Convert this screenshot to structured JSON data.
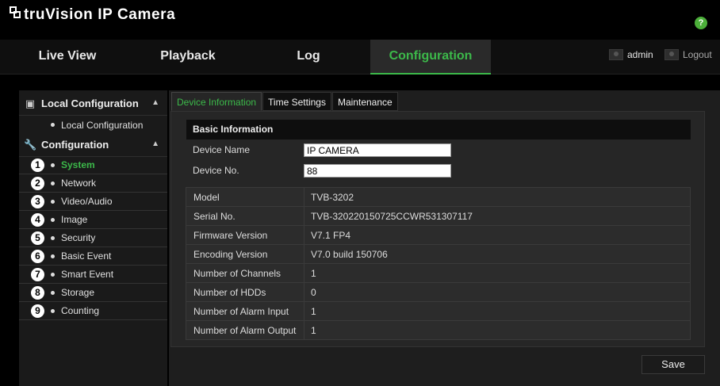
{
  "header": {
    "brand": "truVision  IP Camera",
    "help_glyph": "?"
  },
  "nav": {
    "tabs": [
      "Live View",
      "Playback",
      "Log",
      "Configuration"
    ],
    "active": "Configuration",
    "user_label": "admin",
    "logout_label": "Logout"
  },
  "sidebar": {
    "local": {
      "title": "Local Configuration",
      "items": [
        "Local Configuration"
      ]
    },
    "config": {
      "title": "Configuration",
      "items": [
        {
          "num": "1",
          "label": "System"
        },
        {
          "num": "2",
          "label": "Network"
        },
        {
          "num": "3",
          "label": "Video/Audio"
        },
        {
          "num": "4",
          "label": "Image"
        },
        {
          "num": "5",
          "label": "Security"
        },
        {
          "num": "6",
          "label": "Basic Event"
        },
        {
          "num": "7",
          "label": "Smart Event"
        },
        {
          "num": "8",
          "label": "Storage"
        },
        {
          "num": "9",
          "label": "Counting"
        }
      ]
    }
  },
  "tabs": [
    "Device Information",
    "Time Settings",
    "Maintenance"
  ],
  "basic": {
    "title": "Basic Information",
    "device_name_label": "Device Name",
    "device_name_value": "IP CAMERA",
    "device_no_label": "Device No.",
    "device_no_value": "88"
  },
  "info": [
    {
      "key": "Model",
      "value": "TVB-3202"
    },
    {
      "key": "Serial No.",
      "value": "TVB-320220150725CCWR531307117"
    },
    {
      "key": "Firmware Version",
      "value": "V7.1 FP4"
    },
    {
      "key": "Encoding Version",
      "value": "V7.0 build 150706"
    },
    {
      "key": "Number of Channels",
      "value": "1"
    },
    {
      "key": "Number of HDDs",
      "value": "0"
    },
    {
      "key": "Number of Alarm Input",
      "value": "1"
    },
    {
      "key": "Number of Alarm Output",
      "value": "1"
    }
  ],
  "save_label": "Save",
  "colors": {
    "accent": "#3cb94a",
    "background": "#000000",
    "panel": "#262626"
  }
}
